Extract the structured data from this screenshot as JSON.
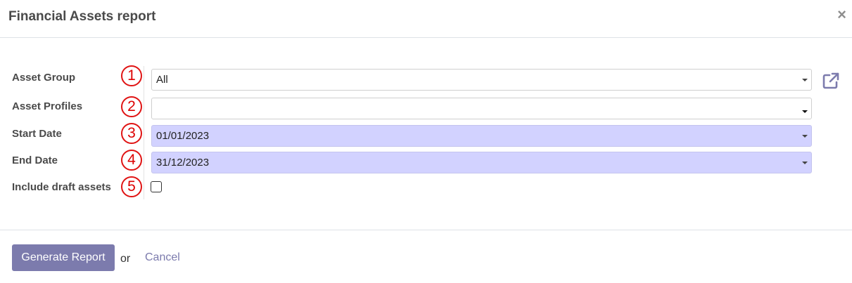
{
  "dialog": {
    "title": "Financial Assets report",
    "close_icon": "close-icon"
  },
  "form": {
    "fields": [
      {
        "label": "Asset Group",
        "marker": "1",
        "value": "All"
      },
      {
        "label": "Asset Profiles",
        "marker": "2",
        "value": ""
      },
      {
        "label": "Start Date",
        "marker": "3",
        "value": "01/01/2023"
      },
      {
        "label": "End Date",
        "marker": "4",
        "value": "31/12/2023"
      },
      {
        "label": "Include draft assets",
        "marker": "5",
        "checked": false
      }
    ],
    "external_link_icon": "external-link-icon"
  },
  "footer": {
    "generate_label": "Generate Report",
    "or_text": "or",
    "cancel_label": "Cancel"
  },
  "colors": {
    "primary": "#7c7bad",
    "required_field_bg": "#d2d2ff",
    "marker_red": "#e01414"
  }
}
